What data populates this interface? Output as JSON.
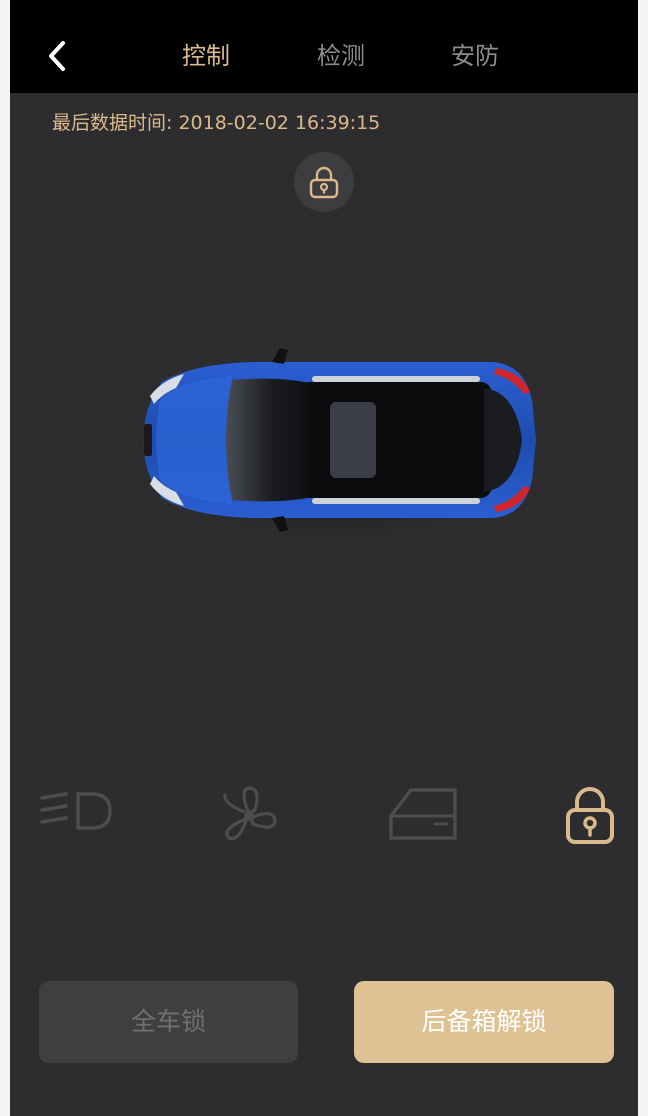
{
  "header": {
    "back_icon": "chevron-left-icon",
    "tabs": [
      {
        "label": "控制",
        "active": true
      },
      {
        "label": "检测",
        "active": false
      },
      {
        "label": "安防",
        "active": false
      }
    ]
  },
  "status": {
    "timestamp_label": "最后数据时间:",
    "timestamp_value": "2018-02-02 16:39:15",
    "lock_icon": "lock-icon"
  },
  "vehicle": {
    "image": "car-top-view",
    "body_color": "#1e4fb8"
  },
  "controls": [
    {
      "icon": "headlight-icon",
      "active": false
    },
    {
      "icon": "fan-icon",
      "active": false
    },
    {
      "icon": "car-door-icon",
      "active": false
    },
    {
      "icon": "lock-icon",
      "active": true
    }
  ],
  "actions": {
    "lock_all_label": "全车锁",
    "unlock_trunk_label": "后备箱解锁"
  },
  "colors": {
    "accent": "#dcb98a",
    "background": "#2d2d2f",
    "header": "#000000",
    "inactive_icon": "#4d4d4f",
    "primary_button": "#dfc294",
    "secondary_button": "#3f3f41"
  }
}
